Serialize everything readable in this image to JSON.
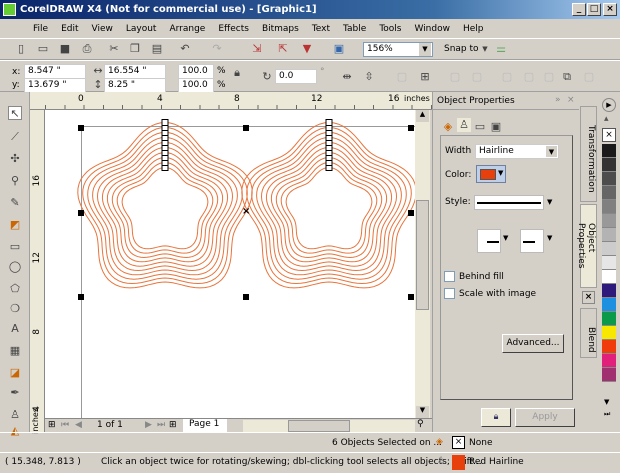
{
  "window": {
    "title": "CorelDRAW X4 (Not for commercial use) - [Graphic1]"
  },
  "menu": [
    "File",
    "Edit",
    "View",
    "Layout",
    "Arrange",
    "Effects",
    "Bitmaps",
    "Text",
    "Table",
    "Tools",
    "Window",
    "Help"
  ],
  "toolbar": {
    "zoom": "156%",
    "snap_to": "Snap to"
  },
  "property_bar": {
    "x": "8.547 \"",
    "y": "13.679 \"",
    "width": "16.554 \"",
    "height": "8.25 \"",
    "scale_x": "100.0",
    "scale_y": "100.0",
    "percent": "%",
    "angle": "0.0",
    "degree": "°"
  },
  "rulers": {
    "top": [
      "0",
      "4",
      "8",
      "12",
      "16"
    ],
    "left": [
      "16",
      "12",
      "8",
      "4"
    ],
    "unit": "inches"
  },
  "page_nav": {
    "count": "1 of 1",
    "tab": "Page 1"
  },
  "docker": {
    "title": "Object Properties",
    "width_label": "Width",
    "width_value": "Hairline",
    "color_label": "Color:",
    "color": "#e8400c",
    "style_label": "Style:",
    "behind_fill": "Behind fill",
    "scale_with_image": "Scale with image",
    "advanced": "Advanced...",
    "apply": "Apply"
  },
  "docker_tabs": [
    "Transformation",
    "Object Properties",
    "Blend"
  ],
  "palette": [
    "#1a1a1a",
    "#333333",
    "#4d4d4d",
    "#666666",
    "#808080",
    "#999999",
    "#b3b3b3",
    "#cccccc",
    "#e6e6e6",
    "#ffffff",
    "#2e1a7a",
    "#1e90e0",
    "#0a9a4a",
    "#f8e800",
    "#f03c0a",
    "#e0207a",
    "#a03070"
  ],
  "shape_color": "#e8743c",
  "status": {
    "selection": "6 Objects Selected on ...",
    "fill": "None",
    "coords": "( 15.348, 7.813 )",
    "hint": "Click an object twice for rotating/skewing; dbl-clicking tool selects all objects; Shift...",
    "outline": "Red  Hairline"
  }
}
